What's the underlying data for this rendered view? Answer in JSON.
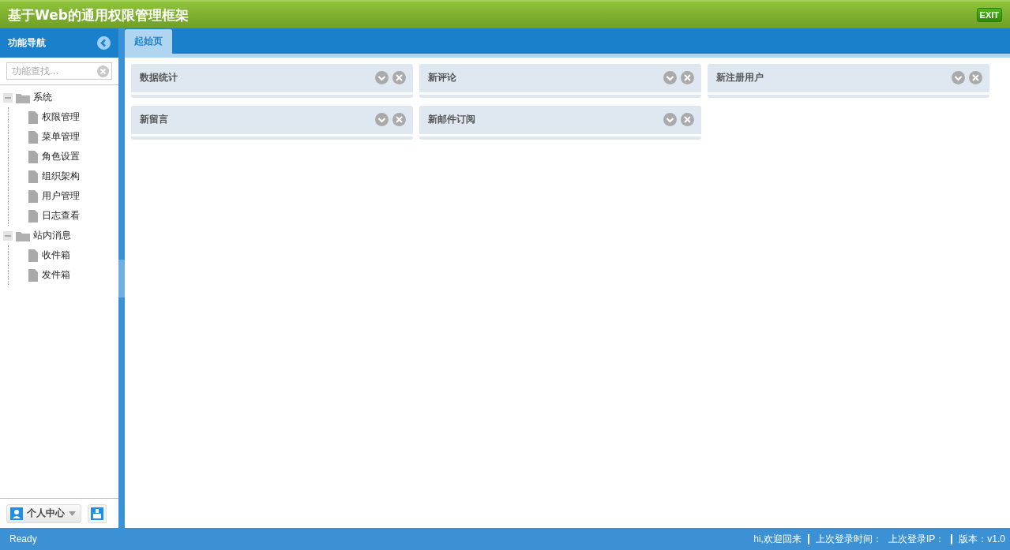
{
  "header": {
    "title": "基于Web的通用权限管理框架",
    "exit_label": "EXIT"
  },
  "sidebar": {
    "title": "功能导航",
    "search": {
      "placeholder": "功能查找..."
    },
    "tree": [
      {
        "label": "系统",
        "expanded": true,
        "children": [
          {
            "label": "权限管理"
          },
          {
            "label": "菜单管理"
          },
          {
            "label": "角色设置"
          },
          {
            "label": "组织架构"
          },
          {
            "label": "用户管理"
          },
          {
            "label": "日志查看"
          }
        ]
      },
      {
        "label": "站内消息",
        "expanded": true,
        "children": [
          {
            "label": "收件箱"
          },
          {
            "label": "发件箱"
          }
        ]
      }
    ],
    "user_menu": "个人中心"
  },
  "tabs": [
    {
      "label": "起始页",
      "selected": true
    }
  ],
  "portlets": [
    {
      "title": "数据统计"
    },
    {
      "title": "新评论"
    },
    {
      "title": "新注册用户"
    },
    {
      "title": "新留言"
    },
    {
      "title": "新邮件订阅"
    }
  ],
  "status_bar": {
    "left": "Ready",
    "right": [
      "hi,欢迎回来",
      "上次登录时间：",
      "上次登录IP：",
      "版本：v1.0"
    ]
  }
}
